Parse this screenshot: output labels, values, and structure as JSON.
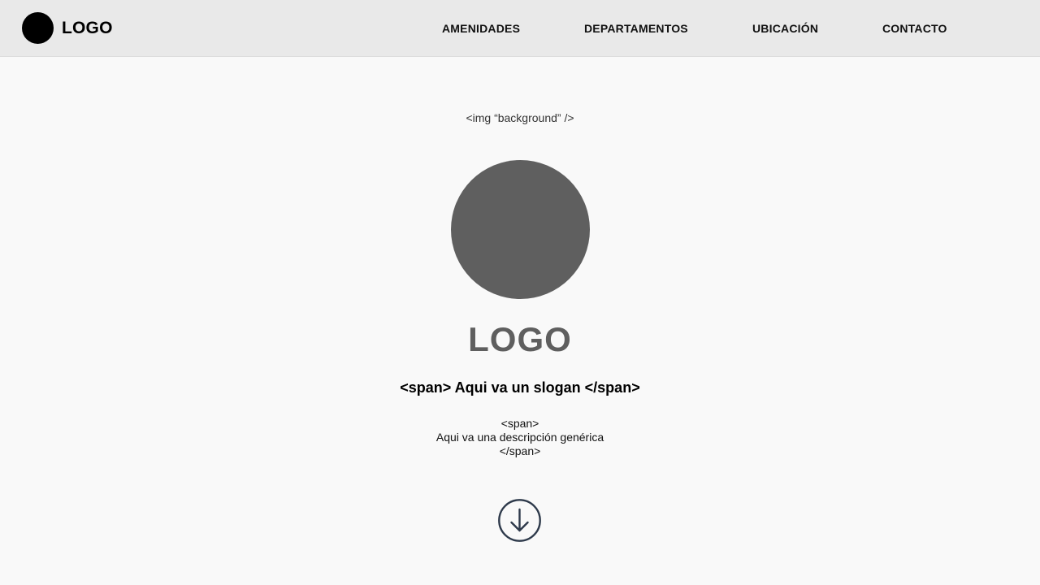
{
  "navbar": {
    "brand_label": "LOGO",
    "links": [
      {
        "label": "AMENIDADES"
      },
      {
        "label": "DEPARTAMENTOS"
      },
      {
        "label": "UBICACIÓN"
      },
      {
        "label": "CONTACTO"
      }
    ]
  },
  "hero": {
    "background_placeholder": "<img “background” />",
    "logo_label": "LOGO",
    "slogan": "<span> Aqui va un slogan </span>",
    "description": {
      "open_tag": "<span>",
      "text": "Aqui va una descripción genérica",
      "close_tag": "</span>"
    },
    "scroll_icon": "arrow-down-circle-icon"
  },
  "colors": {
    "page_background": "#f9f9f9",
    "navbar_background": "#e9e9e9",
    "brand_mark": "#000000",
    "hero_circle": "#5f5f5f",
    "hero_logo_text": "#5f5f5f",
    "scroll_icon_stroke": "#2e3a4b"
  }
}
